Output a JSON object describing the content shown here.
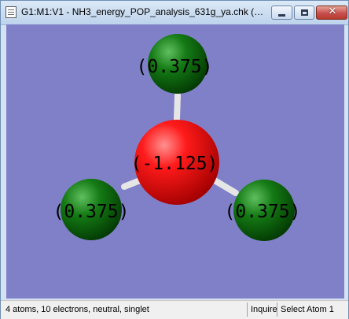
{
  "window": {
    "title": "G1:M1:V1 - NH3_energy_POP_analysis_631g_ya.chk (//icn...",
    "buttons": {
      "minimize_icon": "minimize-icon",
      "maximize_icon": "maximize-icon",
      "close_glyph": "✕"
    }
  },
  "molecule": {
    "atoms": [
      {
        "element": "N",
        "charge_label": "(-1.125)",
        "color": "#e00000"
      },
      {
        "element": "H",
        "charge_label": "(0.375)",
        "color": "#0a5a0a"
      },
      {
        "element": "H",
        "charge_label": "(0.375)",
        "color": "#0a5a0a"
      },
      {
        "element": "H",
        "charge_label": "(0.375)",
        "color": "#0a5a0a"
      }
    ],
    "background_color": "#8080c8",
    "bond_color": "#e6e6e6"
  },
  "status": {
    "summary": "4 atoms, 10 electrons, neutral, singlet",
    "mode": "Inquire",
    "action": "Select Atom 1"
  }
}
